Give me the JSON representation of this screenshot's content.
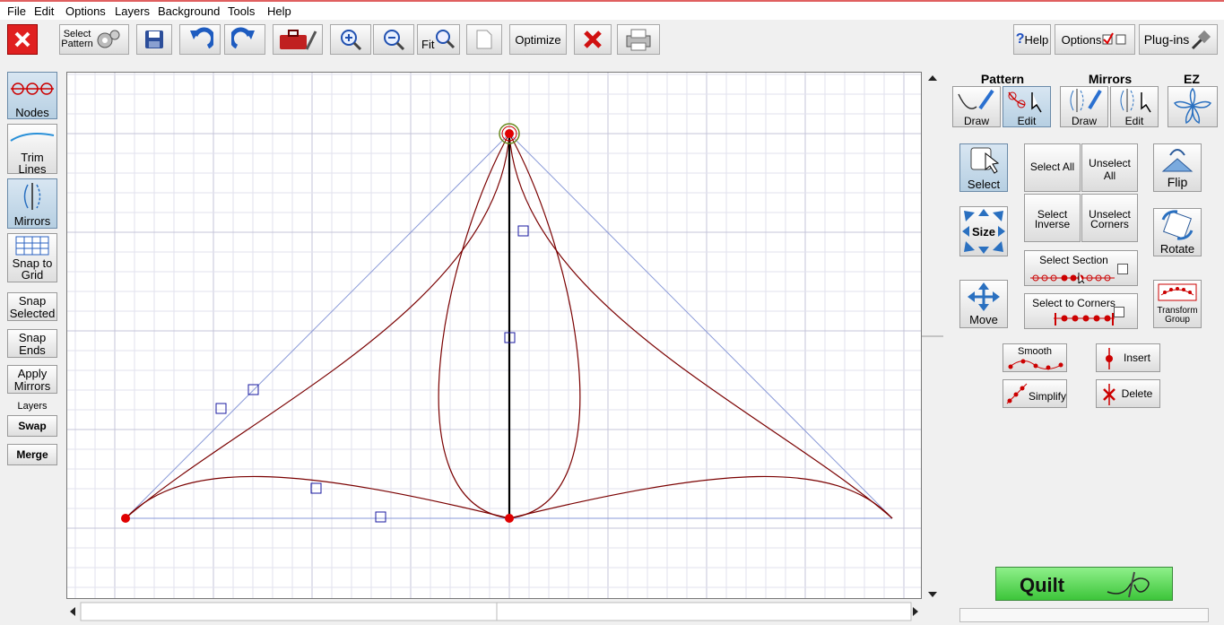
{
  "menu": [
    "File",
    "Edit",
    "Options",
    "Layers",
    "Background",
    "Tools",
    "Help"
  ],
  "toolbar": {
    "select_pattern_line1": "Select",
    "select_pattern_line2": "Pattern",
    "fit_label": "Fit",
    "optimize_label": "Optimize",
    "help_label": "Help",
    "help_prefix": "?",
    "options_label": "Options",
    "plugins_label": "Plug-ins"
  },
  "left_panel": {
    "nodes": "Nodes",
    "trim_lines_1": "Trim",
    "trim_lines_2": "Lines",
    "mirrors": "Mirrors",
    "snap_grid_1": "Snap to",
    "snap_grid_2": "Grid",
    "snap_selected_1": "Snap",
    "snap_selected_2": "Selected",
    "snap_ends_1": "Snap",
    "snap_ends_2": "Ends",
    "apply_mirrors_1": "Apply",
    "apply_mirrors_2": "Mirrors",
    "layers_label": "Layers",
    "swap": "Swap",
    "merge": "Merge"
  },
  "right_panel": {
    "headers": {
      "pattern": "Pattern",
      "mirrors": "Mirrors",
      "ez": "EZ"
    },
    "pattern_draw": "Draw",
    "pattern_edit": "Edit",
    "mirrors_draw": "Draw",
    "mirrors_edit": "Edit",
    "select": "Select",
    "select_all": "Select All",
    "unselect_all_1": "Unselect",
    "unselect_all_2": "All",
    "flip": "Flip",
    "size": "Size",
    "select_inverse_1": "Select",
    "select_inverse_2": "Inverse",
    "unselect_corners_1": "Unselect",
    "unselect_corners_2": "Corners",
    "rotate": "Rotate",
    "select_section": "Select Section",
    "move": "Move",
    "select_to_corners": "Select to Corners",
    "transform_group_1": "Transform",
    "transform_group_2": "Group",
    "smooth": "Smooth",
    "insert": "Insert",
    "simplify": "Simplify",
    "delete": "Delete",
    "quilt": "Quilt"
  },
  "colors": {
    "curve": "#7a0000",
    "node": "#e00000",
    "handle": "#1a1aa0",
    "guide": "#8a9ad8",
    "grid": "#d8d8e8",
    "quilt_green": "#4ccb48"
  }
}
